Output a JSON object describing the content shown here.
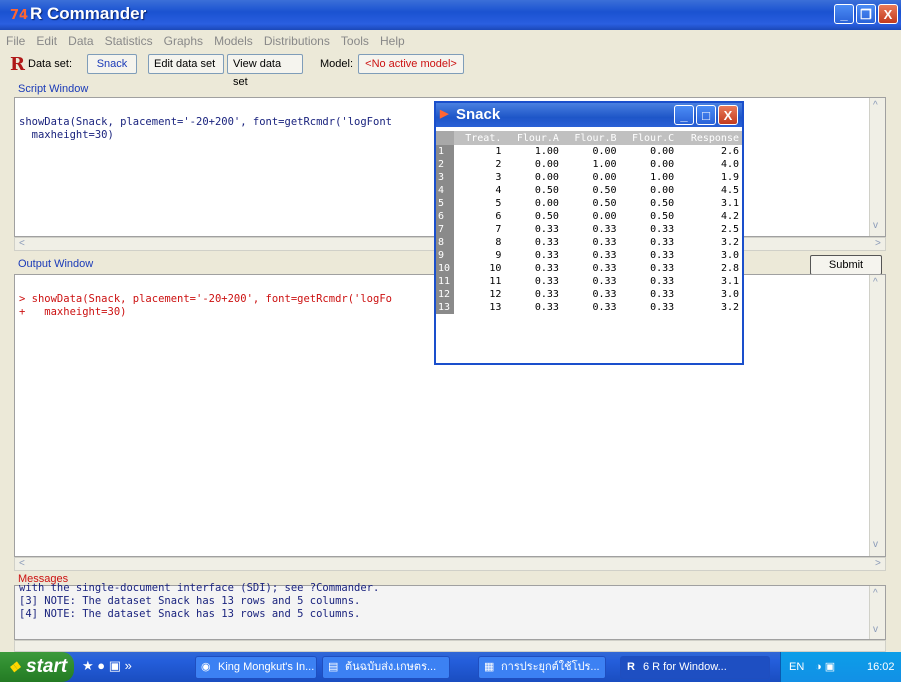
{
  "window": {
    "title": "R Commander",
    "title_icon": "74",
    "buttons": {
      "minimize": "_",
      "maximize": "❐",
      "close": "X"
    }
  },
  "menu": [
    "File",
    "Edit",
    "Data",
    "Statistics",
    "Graphs",
    "Models",
    "Distributions",
    "Tools",
    "Help"
  ],
  "toolbar": {
    "logo": "R",
    "dataset_label": "Data set:",
    "dataset_value": "Snack",
    "edit_button": "Edit data set",
    "view_button": "View data set",
    "model_label": "Model:",
    "model_value": "<No active model>"
  },
  "script_window": {
    "label": "Script Window",
    "lines": [
      "showData(Snack, placement='-20+200', font=getRcmdr('logFont",
      "  maxheight=30)"
    ]
  },
  "submit_button": "Submit",
  "output_window": {
    "label": "Output Window",
    "lines": [
      "> showData(Snack, placement='-20+200', font=getRcmdr('logFo",
      "+   maxheight=30)"
    ]
  },
  "messages": {
    "label": "Messages",
    "lines": [
      "with the single-document interface (SDI); see ?Commander.",
      "[3] NOTE: The dataset Snack has 13 rows and 5 columns.",
      "[4] NOTE: The dataset Snack has 13 rows and 5 columns."
    ]
  },
  "snack_window": {
    "title": "Snack",
    "headers": [
      "Treat.",
      "Flour.A",
      "Flour.B",
      "Flour.C",
      "Response"
    ],
    "rows": [
      [
        "1",
        "1",
        "1.00",
        "0.00",
        "0.00",
        "2.6"
      ],
      [
        "2",
        "2",
        "0.00",
        "1.00",
        "0.00",
        "4.0"
      ],
      [
        "3",
        "3",
        "0.00",
        "0.00",
        "1.00",
        "1.9"
      ],
      [
        "4",
        "4",
        "0.50",
        "0.50",
        "0.00",
        "4.5"
      ],
      [
        "5",
        "5",
        "0.00",
        "0.50",
        "0.50",
        "3.1"
      ],
      [
        "6",
        "6",
        "0.50",
        "0.00",
        "0.50",
        "4.2"
      ],
      [
        "7",
        "7",
        "0.33",
        "0.33",
        "0.33",
        "2.5"
      ],
      [
        "8",
        "8",
        "0.33",
        "0.33",
        "0.33",
        "3.2"
      ],
      [
        "9",
        "9",
        "0.33",
        "0.33",
        "0.33",
        "3.0"
      ],
      [
        "10",
        "10",
        "0.33",
        "0.33",
        "0.33",
        "2.8"
      ],
      [
        "11",
        "11",
        "0.33",
        "0.33",
        "0.33",
        "3.1"
      ],
      [
        "12",
        "12",
        "0.33",
        "0.33",
        "0.33",
        "3.0"
      ],
      [
        "13",
        "13",
        "0.33",
        "0.33",
        "0.33",
        "3.2"
      ]
    ]
  },
  "taskbar": {
    "start": "start",
    "items": [
      "King Mongkut's In...",
      "ต้นฉบับส่ง.เกษตร...",
      "การประยุกต์ใช้โปร...",
      "6 R for Window..."
    ],
    "lang": "EN",
    "time": "16:02"
  },
  "colors": {
    "title_blue": "#1a52d1",
    "console_red": "#cc1111",
    "message_navy": "#1a237e",
    "start_green": "#2e8b2e"
  }
}
